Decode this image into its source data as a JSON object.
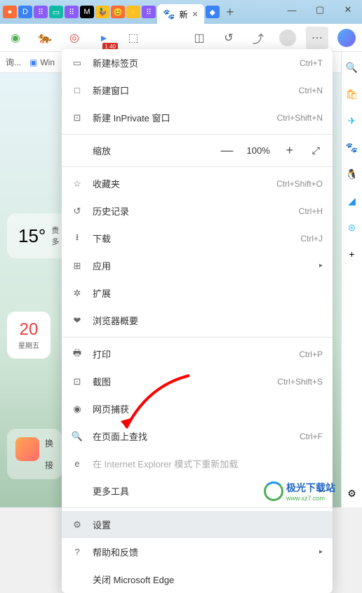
{
  "window": {
    "min": "—",
    "max": "▢",
    "close": "✕"
  },
  "active_tab": {
    "title": "新",
    "icon": "🐾"
  },
  "new_tab": "+",
  "toolbar": {
    "badge": "1.40"
  },
  "bookmarks": {
    "item1": "询...",
    "item2": "Win"
  },
  "weather": {
    "temp": "15°",
    "l1": "贵",
    "l2": "多"
  },
  "date": {
    "num": "20",
    "day": "星期五"
  },
  "cards": {
    "huan": "换",
    "jie": "接"
  },
  "menu": {
    "new_tab": "新建标签页",
    "new_tab_sc": "Ctrl+T",
    "new_window": "新建窗口",
    "new_window_sc": "Ctrl+N",
    "new_inprivate": "新建 InPrivate 窗口",
    "new_inprivate_sc": "Ctrl+Shift+N",
    "zoom": "缩放",
    "zoom_pct": "100%",
    "favorites": "收藏夹",
    "favorites_sc": "Ctrl+Shift+O",
    "history": "历史记录",
    "history_sc": "Ctrl+H",
    "downloads": "下载",
    "downloads_sc": "Ctrl+J",
    "apps": "应用",
    "extensions": "扩展",
    "browser": "浏览器概要",
    "print": "打印",
    "print_sc": "Ctrl+P",
    "screenshot": "截图",
    "screenshot_sc": "Ctrl+Shift+S",
    "web_capture": "网页捕获",
    "find": "在页面上查找",
    "find_sc": "Ctrl+F",
    "ie_reload": "在 Internet Explorer 模式下重新加载",
    "more_tools": "更多工具",
    "settings": "设置",
    "help": "帮助和反馈",
    "close_edge": "关闭 Microsoft Edge"
  },
  "watermark": {
    "name": "极光下载站",
    "url": "www.xz7.com"
  }
}
